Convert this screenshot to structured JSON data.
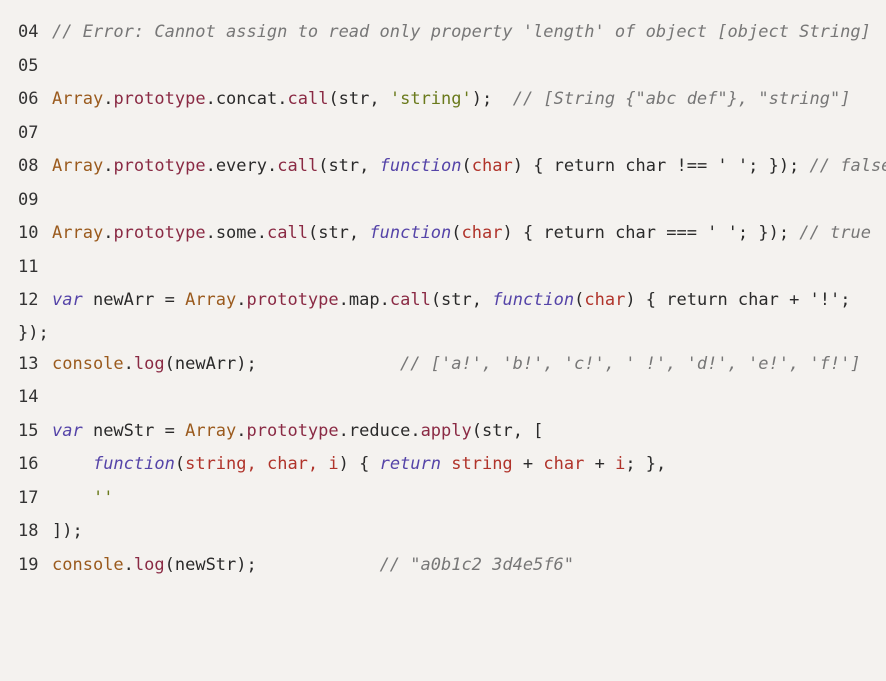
{
  "lines": [
    {
      "n": "04",
      "tokens": [
        {
          "t": "// Error: Cannot assign to read only property 'length' of object [object String]",
          "c": "comment"
        }
      ]
    },
    {
      "n": "05",
      "tokens": []
    },
    {
      "n": "06",
      "tokens": [
        {
          "t": "Array",
          "c": "obj"
        },
        {
          "t": ".",
          "c": "plain"
        },
        {
          "t": "prototype",
          "c": "prop"
        },
        {
          "t": ".",
          "c": "plain"
        },
        {
          "t": "concat",
          "c": "plain"
        },
        {
          "t": ".",
          "c": "plain"
        },
        {
          "t": "call",
          "c": "prop"
        },
        {
          "t": "(str, ",
          "c": "plain"
        },
        {
          "t": "'string'",
          "c": "str"
        },
        {
          "t": ");  ",
          "c": "plain"
        },
        {
          "t": "// [String {\"abc def\"}, \"string\"]",
          "c": "comment"
        }
      ]
    },
    {
      "n": "07",
      "tokens": []
    },
    {
      "n": "08",
      "tokens": [
        {
          "t": "Array",
          "c": "obj"
        },
        {
          "t": ".",
          "c": "plain"
        },
        {
          "t": "prototype",
          "c": "prop"
        },
        {
          "t": ".",
          "c": "plain"
        },
        {
          "t": "every",
          "c": "plain"
        },
        {
          "t": ".",
          "c": "plain"
        },
        {
          "t": "call",
          "c": "prop"
        },
        {
          "t": "(str, ",
          "c": "plain"
        },
        {
          "t": "function",
          "c": "fnkw"
        },
        {
          "t": "(",
          "c": "plain"
        },
        {
          "t": "char",
          "c": "param"
        },
        {
          "t": ") { return char !== ' '; }); ",
          "c": "plain"
        },
        {
          "t": "// false",
          "c": "comment"
        }
      ]
    },
    {
      "n": "09",
      "tokens": []
    },
    {
      "n": "10",
      "tokens": [
        {
          "t": "Array",
          "c": "obj"
        },
        {
          "t": ".",
          "c": "plain"
        },
        {
          "t": "prototype",
          "c": "prop"
        },
        {
          "t": ".",
          "c": "plain"
        },
        {
          "t": "some",
          "c": "plain"
        },
        {
          "t": ".",
          "c": "plain"
        },
        {
          "t": "call",
          "c": "prop"
        },
        {
          "t": "(str, ",
          "c": "plain"
        },
        {
          "t": "function",
          "c": "fnkw"
        },
        {
          "t": "(",
          "c": "plain"
        },
        {
          "t": "char",
          "c": "param"
        },
        {
          "t": ") { return char === ' '; }); ",
          "c": "plain"
        },
        {
          "t": "// true",
          "c": "comment"
        }
      ]
    },
    {
      "n": "11",
      "tokens": []
    },
    {
      "n": "12",
      "tokens": [
        {
          "t": "var",
          "c": "fnkw"
        },
        {
          "t": " newArr = ",
          "c": "plain"
        },
        {
          "t": "Array",
          "c": "obj"
        },
        {
          "t": ".",
          "c": "plain"
        },
        {
          "t": "prototype",
          "c": "prop"
        },
        {
          "t": ".",
          "c": "plain"
        },
        {
          "t": "map",
          "c": "plain"
        },
        {
          "t": ".",
          "c": "plain"
        },
        {
          "t": "call",
          "c": "prop"
        },
        {
          "t": "(str, ",
          "c": "plain"
        },
        {
          "t": "function",
          "c": "fnkw"
        },
        {
          "t": "(",
          "c": "plain"
        },
        {
          "t": "char",
          "c": "param"
        },
        {
          "t": ") { return char + '!';",
          "c": "plain"
        }
      ]
    },
    {
      "n": "",
      "wrap": true,
      "tokens": [
        {
          "t": "});",
          "c": "plain"
        }
      ]
    },
    {
      "n": "13",
      "tokens": [
        {
          "t": "console",
          "c": "obj"
        },
        {
          "t": ".",
          "c": "plain"
        },
        {
          "t": "log",
          "c": "prop"
        },
        {
          "t": "(newArr);              ",
          "c": "plain"
        },
        {
          "t": "// ['a!', 'b!', 'c!', ' !', 'd!', 'e!', 'f!']",
          "c": "comment"
        }
      ]
    },
    {
      "n": "14",
      "tokens": []
    },
    {
      "n": "15",
      "tokens": [
        {
          "t": "var",
          "c": "fnkw"
        },
        {
          "t": " newStr = ",
          "c": "plain"
        },
        {
          "t": "Array",
          "c": "obj"
        },
        {
          "t": ".",
          "c": "plain"
        },
        {
          "t": "prototype",
          "c": "prop"
        },
        {
          "t": ".",
          "c": "plain"
        },
        {
          "t": "reduce",
          "c": "plain"
        },
        {
          "t": ".",
          "c": "plain"
        },
        {
          "t": "apply",
          "c": "prop"
        },
        {
          "t": "(str, [",
          "c": "plain"
        }
      ]
    },
    {
      "n": "16",
      "tokens": [
        {
          "t": "    ",
          "c": "plain"
        },
        {
          "t": "function",
          "c": "fnkw"
        },
        {
          "t": "(",
          "c": "plain"
        },
        {
          "t": "string, char, i",
          "c": "param"
        },
        {
          "t": ") { ",
          "c": "plain"
        },
        {
          "t": "return",
          "c": "fnkw"
        },
        {
          "t": " ",
          "c": "plain"
        },
        {
          "t": "string",
          "c": "param"
        },
        {
          "t": " + ",
          "c": "plain"
        },
        {
          "t": "char",
          "c": "param"
        },
        {
          "t": " + ",
          "c": "plain"
        },
        {
          "t": "i",
          "c": "param"
        },
        {
          "t": "; },",
          "c": "plain"
        }
      ]
    },
    {
      "n": "17",
      "tokens": [
        {
          "t": "    ",
          "c": "plain"
        },
        {
          "t": "''",
          "c": "str"
        }
      ]
    },
    {
      "n": "18",
      "tokens": [
        {
          "t": "]);",
          "c": "plain"
        }
      ]
    },
    {
      "n": "19",
      "tokens": [
        {
          "t": "console",
          "c": "obj"
        },
        {
          "t": ".",
          "c": "plain"
        },
        {
          "t": "log",
          "c": "prop"
        },
        {
          "t": "(newStr);            ",
          "c": "plain"
        },
        {
          "t": "// \"a0b1c2 3d4e5f6\"",
          "c": "comment"
        }
      ]
    }
  ]
}
